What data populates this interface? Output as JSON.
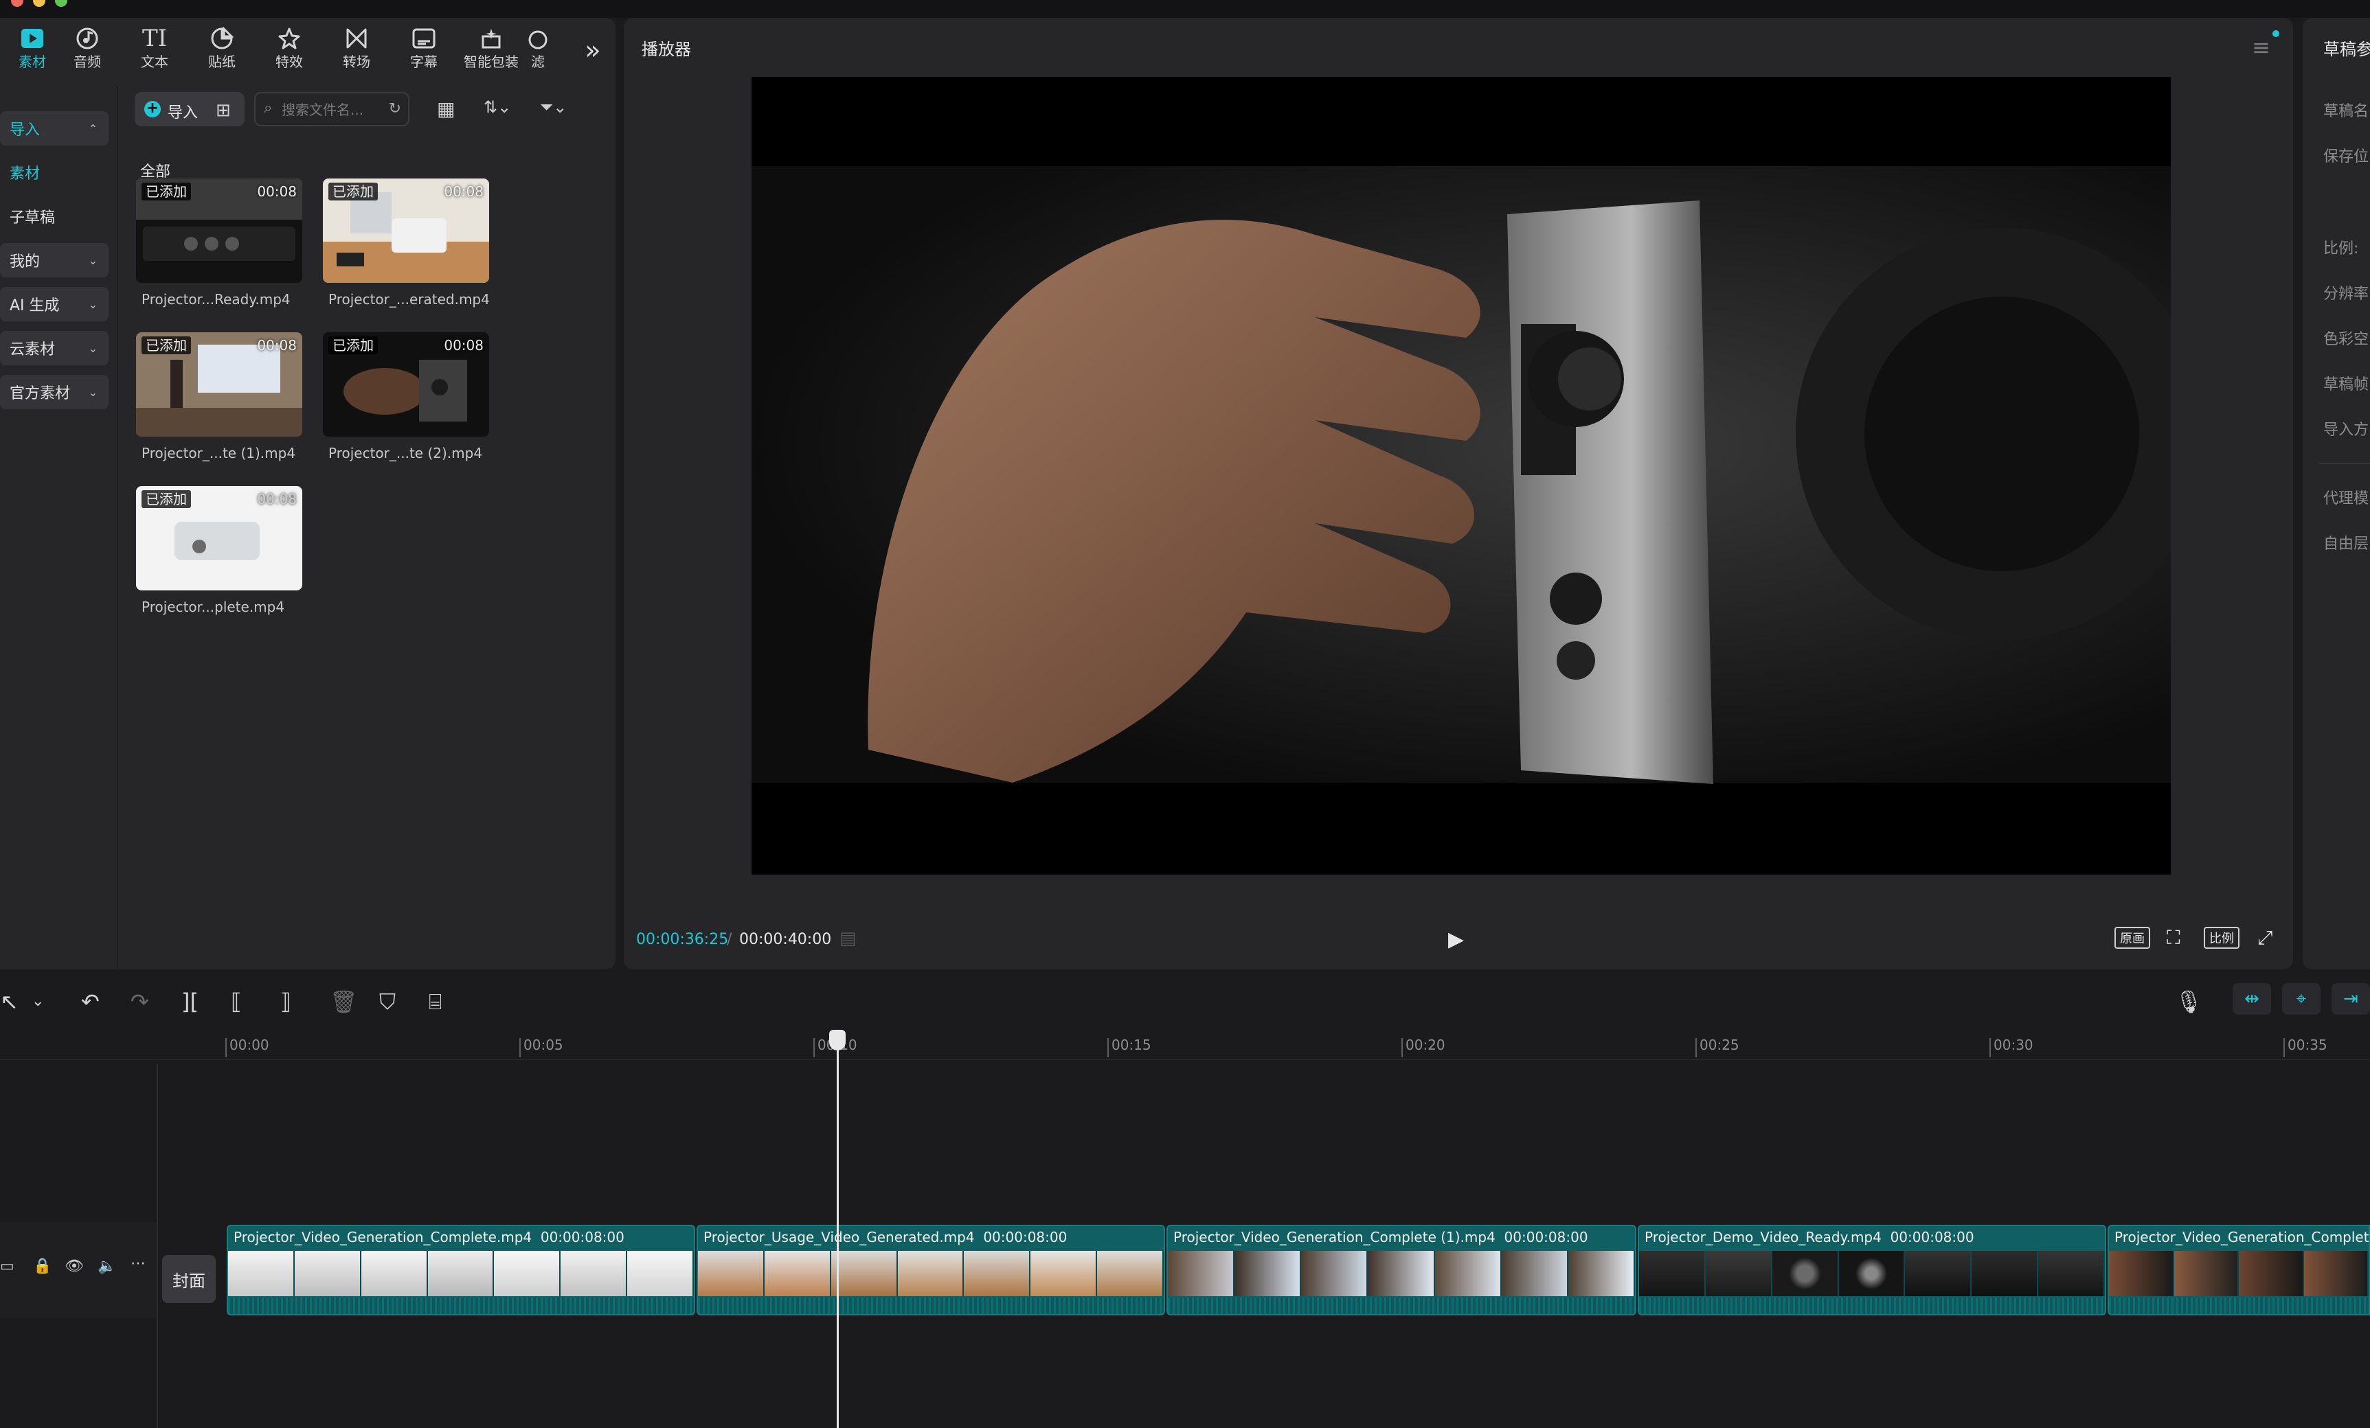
{
  "toolbar": {
    "tabs": [
      {
        "label": "素材",
        "icon": "media-icon"
      },
      {
        "label": "音频",
        "icon": "audio-icon"
      },
      {
        "label": "文本",
        "icon": "text-icon"
      },
      {
        "label": "贴纸",
        "icon": "sticker-icon"
      },
      {
        "label": "特效",
        "icon": "effects-icon"
      },
      {
        "label": "转场",
        "icon": "transition-icon"
      },
      {
        "label": "字幕",
        "icon": "subtitle-icon"
      },
      {
        "label": "智能包装",
        "icon": "smart-pack-icon"
      },
      {
        "label": "滤",
        "icon": "filter-icon"
      }
    ]
  },
  "sidebar": {
    "items": [
      {
        "label": "导入",
        "expanded": true
      },
      {
        "label": "素材"
      },
      {
        "label": "子草稿"
      },
      {
        "label": "我的"
      },
      {
        "label": "AI 生成"
      },
      {
        "label": "云素材"
      },
      {
        "label": "官方素材"
      }
    ]
  },
  "media": {
    "import_label": "导入",
    "search_placeholder": "搜索文件名...",
    "section_label": "全部",
    "badge": "已添加",
    "items": [
      {
        "name": "Projector...Ready.mp4",
        "duration": "00:08"
      },
      {
        "name": "Projector_...erated.mp4",
        "duration": "00:08"
      },
      {
        "name": "Projector_...te (1).mp4",
        "duration": "00:08"
      },
      {
        "name": "Projector_...te (2).mp4",
        "duration": "00:08"
      },
      {
        "name": "Projector...plete.mp4",
        "duration": "00:08"
      }
    ]
  },
  "player": {
    "title": "播放器",
    "current_time": "00:00:36:25",
    "total_time": "00:00:40:00",
    "btn_original": "原画",
    "btn_ratio": "比例"
  },
  "right_panel": {
    "title": "草稿参",
    "fields": [
      "草稿名",
      "保存位",
      "比例:",
      "分辨率",
      "色彩空",
      "草稿帧",
      "导入方",
      "代理模",
      "自由层"
    ]
  },
  "timeline": {
    "ruler": [
      "00:00",
      "00:05",
      "00:10",
      "00:15",
      "00:20",
      "00:25",
      "00:30",
      "00:35"
    ],
    "cover_label": "封面",
    "clips": [
      {
        "name": "Projector_Video_Generation_Complete.mp4",
        "duration": "00:00:08:00"
      },
      {
        "name": "Projector_Usage_Video_Generated.mp4",
        "duration": "00:00:08:00"
      },
      {
        "name": "Projector_Video_Generation_Complete (1).mp4",
        "duration": "00:00:08:00"
      },
      {
        "name": "Projector_Demo_Video_Ready.mp4",
        "duration": "00:00:08:00"
      },
      {
        "name": "Projector_Video_Generation_Complete",
        "duration": ""
      }
    ]
  },
  "colors": {
    "accent": "#21c6d6",
    "clip": "#0f5f63",
    "panel": "#262629",
    "background": "#1b1b1e"
  }
}
